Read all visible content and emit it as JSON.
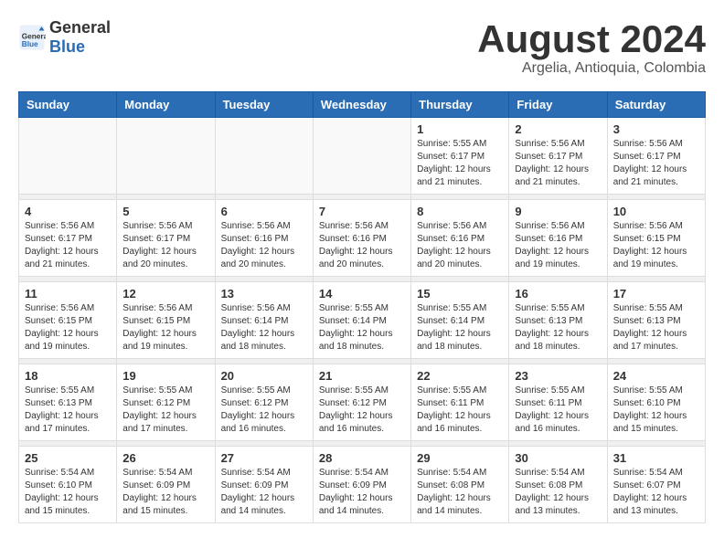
{
  "logo": {
    "text_general": "General",
    "text_blue": "Blue"
  },
  "title": "August 2024",
  "subtitle": "Argelia, Antioquia, Colombia",
  "weekdays": [
    "Sunday",
    "Monday",
    "Tuesday",
    "Wednesday",
    "Thursday",
    "Friday",
    "Saturday"
  ],
  "weeks": [
    [
      {
        "day": "",
        "info": ""
      },
      {
        "day": "",
        "info": ""
      },
      {
        "day": "",
        "info": ""
      },
      {
        "day": "",
        "info": ""
      },
      {
        "day": "1",
        "info": "Sunrise: 5:55 AM\nSunset: 6:17 PM\nDaylight: 12 hours\nand 21 minutes."
      },
      {
        "day": "2",
        "info": "Sunrise: 5:56 AM\nSunset: 6:17 PM\nDaylight: 12 hours\nand 21 minutes."
      },
      {
        "day": "3",
        "info": "Sunrise: 5:56 AM\nSunset: 6:17 PM\nDaylight: 12 hours\nand 21 minutes."
      }
    ],
    [
      {
        "day": "4",
        "info": "Sunrise: 5:56 AM\nSunset: 6:17 PM\nDaylight: 12 hours\nand 21 minutes."
      },
      {
        "day": "5",
        "info": "Sunrise: 5:56 AM\nSunset: 6:17 PM\nDaylight: 12 hours\nand 20 minutes."
      },
      {
        "day": "6",
        "info": "Sunrise: 5:56 AM\nSunset: 6:16 PM\nDaylight: 12 hours\nand 20 minutes."
      },
      {
        "day": "7",
        "info": "Sunrise: 5:56 AM\nSunset: 6:16 PM\nDaylight: 12 hours\nand 20 minutes."
      },
      {
        "day": "8",
        "info": "Sunrise: 5:56 AM\nSunset: 6:16 PM\nDaylight: 12 hours\nand 20 minutes."
      },
      {
        "day": "9",
        "info": "Sunrise: 5:56 AM\nSunset: 6:16 PM\nDaylight: 12 hours\nand 19 minutes."
      },
      {
        "day": "10",
        "info": "Sunrise: 5:56 AM\nSunset: 6:15 PM\nDaylight: 12 hours\nand 19 minutes."
      }
    ],
    [
      {
        "day": "11",
        "info": "Sunrise: 5:56 AM\nSunset: 6:15 PM\nDaylight: 12 hours\nand 19 minutes."
      },
      {
        "day": "12",
        "info": "Sunrise: 5:56 AM\nSunset: 6:15 PM\nDaylight: 12 hours\nand 19 minutes."
      },
      {
        "day": "13",
        "info": "Sunrise: 5:56 AM\nSunset: 6:14 PM\nDaylight: 12 hours\nand 18 minutes."
      },
      {
        "day": "14",
        "info": "Sunrise: 5:55 AM\nSunset: 6:14 PM\nDaylight: 12 hours\nand 18 minutes."
      },
      {
        "day": "15",
        "info": "Sunrise: 5:55 AM\nSunset: 6:14 PM\nDaylight: 12 hours\nand 18 minutes."
      },
      {
        "day": "16",
        "info": "Sunrise: 5:55 AM\nSunset: 6:13 PM\nDaylight: 12 hours\nand 18 minutes."
      },
      {
        "day": "17",
        "info": "Sunrise: 5:55 AM\nSunset: 6:13 PM\nDaylight: 12 hours\nand 17 minutes."
      }
    ],
    [
      {
        "day": "18",
        "info": "Sunrise: 5:55 AM\nSunset: 6:13 PM\nDaylight: 12 hours\nand 17 minutes."
      },
      {
        "day": "19",
        "info": "Sunrise: 5:55 AM\nSunset: 6:12 PM\nDaylight: 12 hours\nand 17 minutes."
      },
      {
        "day": "20",
        "info": "Sunrise: 5:55 AM\nSunset: 6:12 PM\nDaylight: 12 hours\nand 16 minutes."
      },
      {
        "day": "21",
        "info": "Sunrise: 5:55 AM\nSunset: 6:12 PM\nDaylight: 12 hours\nand 16 minutes."
      },
      {
        "day": "22",
        "info": "Sunrise: 5:55 AM\nSunset: 6:11 PM\nDaylight: 12 hours\nand 16 minutes."
      },
      {
        "day": "23",
        "info": "Sunrise: 5:55 AM\nSunset: 6:11 PM\nDaylight: 12 hours\nand 16 minutes."
      },
      {
        "day": "24",
        "info": "Sunrise: 5:55 AM\nSunset: 6:10 PM\nDaylight: 12 hours\nand 15 minutes."
      }
    ],
    [
      {
        "day": "25",
        "info": "Sunrise: 5:54 AM\nSunset: 6:10 PM\nDaylight: 12 hours\nand 15 minutes."
      },
      {
        "day": "26",
        "info": "Sunrise: 5:54 AM\nSunset: 6:09 PM\nDaylight: 12 hours\nand 15 minutes."
      },
      {
        "day": "27",
        "info": "Sunrise: 5:54 AM\nSunset: 6:09 PM\nDaylight: 12 hours\nand 14 minutes."
      },
      {
        "day": "28",
        "info": "Sunrise: 5:54 AM\nSunset: 6:09 PM\nDaylight: 12 hours\nand 14 minutes."
      },
      {
        "day": "29",
        "info": "Sunrise: 5:54 AM\nSunset: 6:08 PM\nDaylight: 12 hours\nand 14 minutes."
      },
      {
        "day": "30",
        "info": "Sunrise: 5:54 AM\nSunset: 6:08 PM\nDaylight: 12 hours\nand 13 minutes."
      },
      {
        "day": "31",
        "info": "Sunrise: 5:54 AM\nSunset: 6:07 PM\nDaylight: 12 hours\nand 13 minutes."
      }
    ]
  ]
}
